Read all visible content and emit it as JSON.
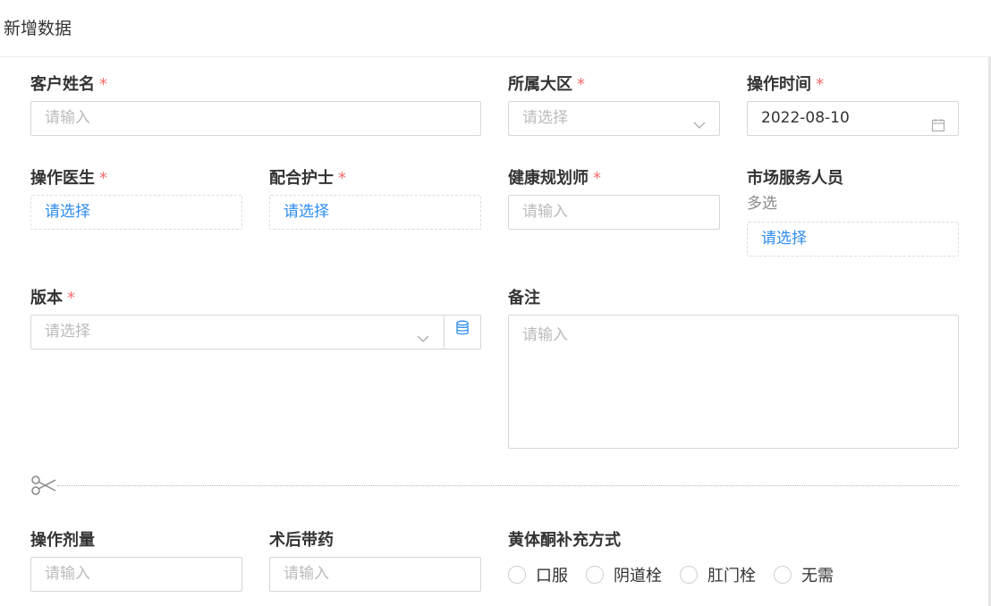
{
  "header": {
    "title": "新增数据"
  },
  "fields": {
    "customer_name": {
      "label": "客户姓名",
      "required": "*",
      "placeholder": "请输入"
    },
    "region": {
      "label": "所属大区",
      "required": "*",
      "placeholder": "请选择"
    },
    "operation_time": {
      "label": "操作时间",
      "required": "*",
      "value": "2022-08-10"
    },
    "doctor": {
      "label": "操作医生",
      "required": "*",
      "placeholder": "请选择"
    },
    "nurse": {
      "label": "配合护士",
      "required": "*",
      "placeholder": "请选择"
    },
    "health_planner": {
      "label": "健康规划师",
      "required": "*",
      "placeholder": "请输入"
    },
    "market_staff": {
      "label": "市场服务人员",
      "hint": "多选",
      "placeholder": "请选择"
    },
    "version": {
      "label": "版本",
      "required": "*",
      "placeholder": "请选择"
    },
    "remark": {
      "label": "备注",
      "placeholder": "请输入"
    },
    "dosage": {
      "label": "操作剂量",
      "placeholder": "请输入"
    },
    "post_op_medicine": {
      "label": "术后带药",
      "placeholder": "请输入"
    },
    "progesterone": {
      "label": "黄体酮补充方式",
      "options": [
        "口服",
        "阴道栓",
        "肛门栓",
        "无需"
      ]
    }
  },
  "colors": {
    "required": "#f56c6c",
    "link": "#2d8cf0",
    "border": "#d7d7d7"
  }
}
